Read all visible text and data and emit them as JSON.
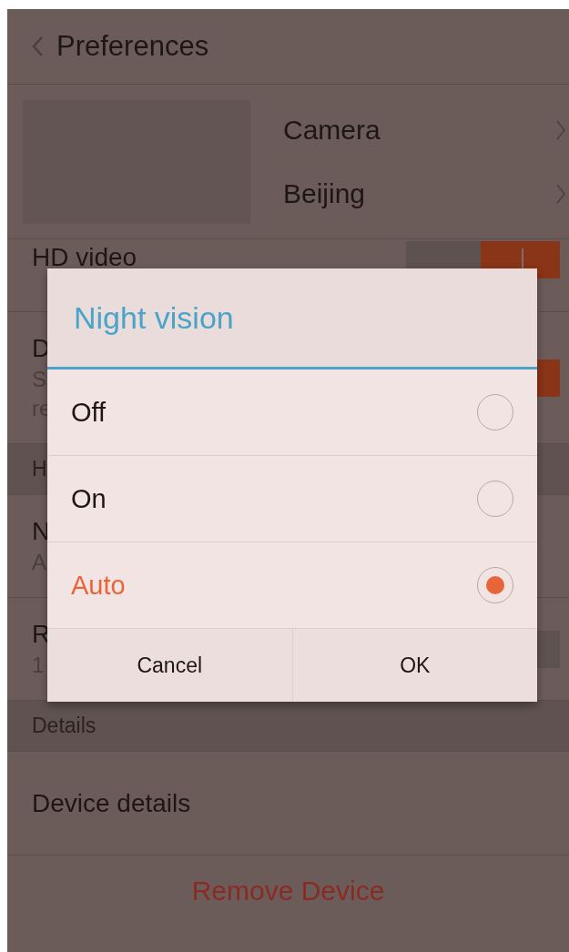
{
  "header": {
    "title": "Preferences"
  },
  "device": {
    "name": "Camera",
    "location": "Beijing"
  },
  "list": [
    {
      "kind": "toggle",
      "title": "HD video",
      "on": true
    },
    {
      "kind": "toggle",
      "title": "D",
      "subtitle": [
        "S",
        "re"
      ],
      "on": true
    },
    {
      "kind": "section",
      "title": "H"
    },
    {
      "kind": "value",
      "title": "N",
      "subtitle": [
        "A"
      ]
    },
    {
      "kind": "toggle",
      "title": "R",
      "subtitle": [
        "1"
      ],
      "on": false
    },
    {
      "kind": "section",
      "title": "Details"
    },
    {
      "kind": "link",
      "title": "Device details"
    },
    {
      "kind": "action",
      "title": "Remove Device"
    }
  ],
  "dialog": {
    "title": "Night vision",
    "options": [
      {
        "label": "Off",
        "selected": false
      },
      {
        "label": "On",
        "selected": false
      },
      {
        "label": "Auto",
        "selected": true
      }
    ],
    "buttons": [
      "Cancel",
      "OK"
    ]
  }
}
